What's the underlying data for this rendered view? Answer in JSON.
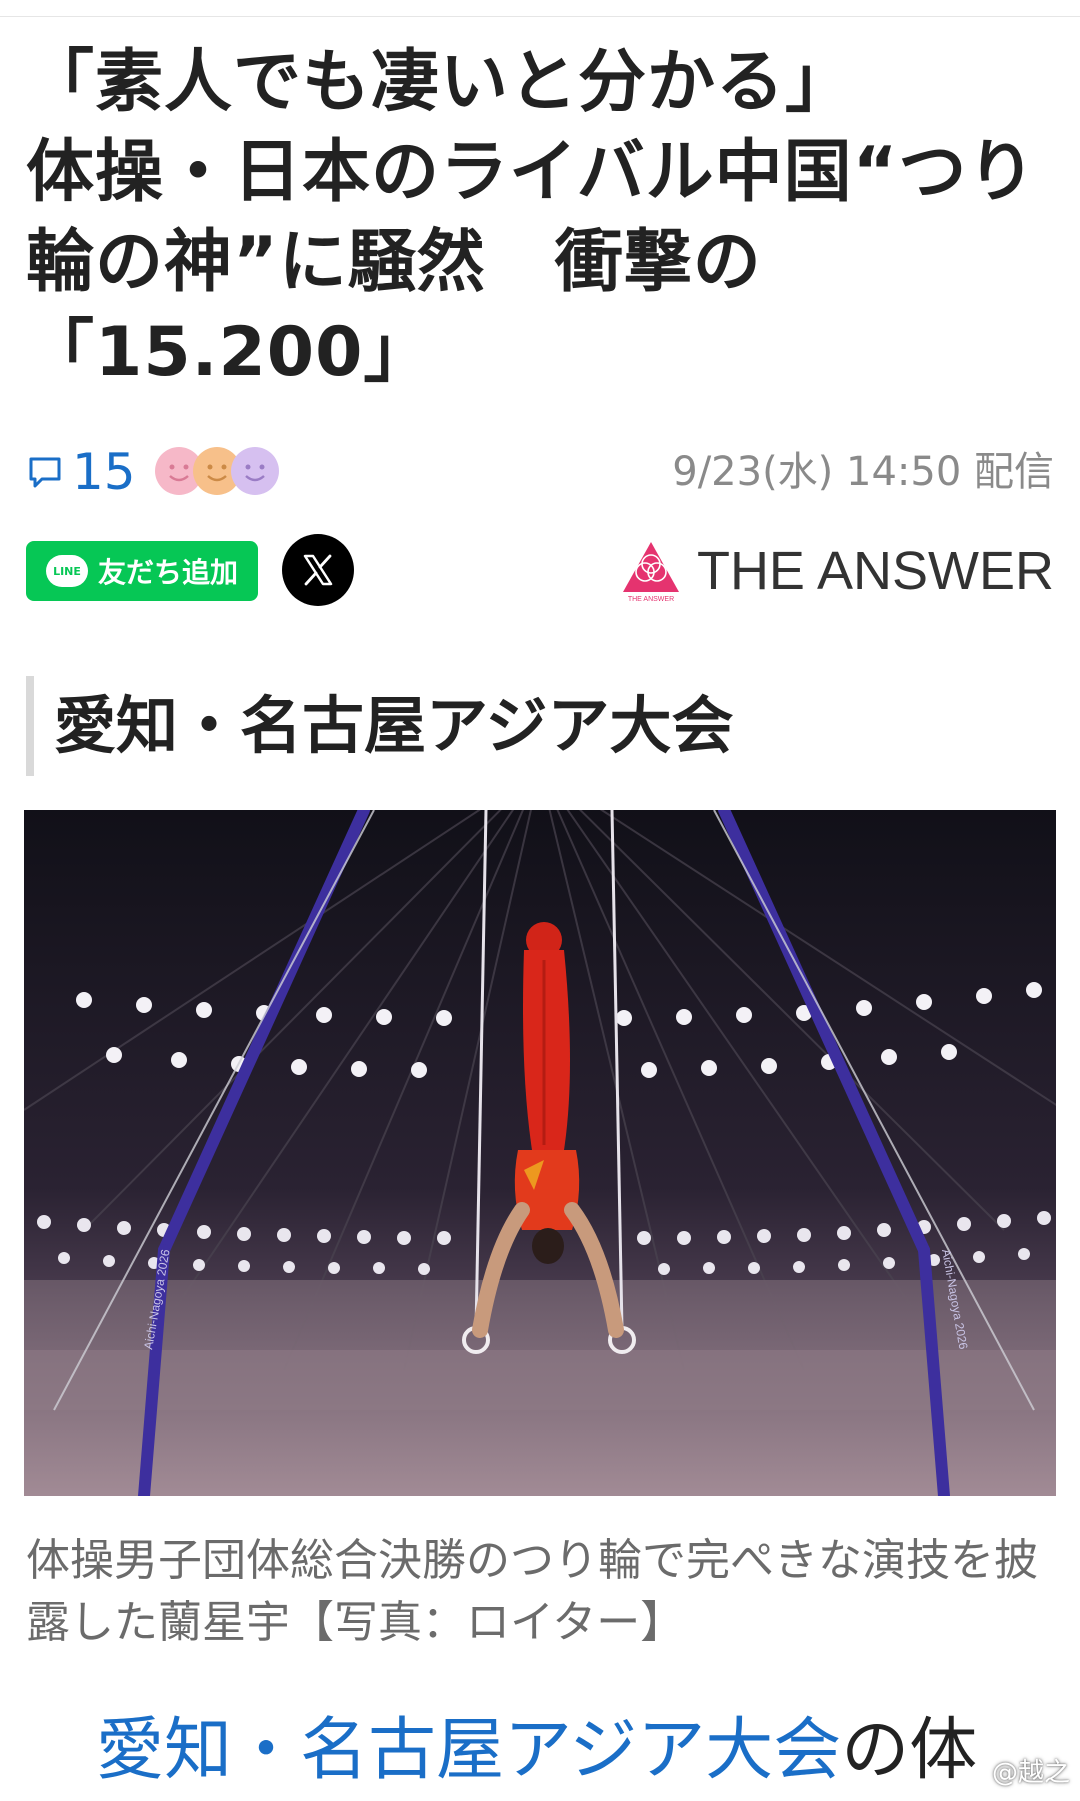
{
  "article": {
    "headline": "「素人でも凄いと分かる」\n体操・日本のライバル中国“つり輪の神”に騒然　衝撃の\n「15.200」",
    "comment_count": "15",
    "publish_time": "9/23(水) 14:50 配信",
    "section_heading": "愛知・名古屋アジア大会",
    "photo_caption": "体操男子団体総合決勝のつり輪で完ぺきな演技を披露した蘭星宇【写真：ロイター】",
    "lead_link": "愛知・名古屋アジア大会",
    "lead_rest": "の体"
  },
  "reactions": [
    {
      "icon": "smile-face-pink",
      "color": "#f6b8c8"
    },
    {
      "icon": "smile-face-orange",
      "color": "#f7c08a"
    },
    {
      "icon": "smile-face-purple",
      "color": "#d6c0f0"
    }
  ],
  "share": {
    "line_badge": "LINE",
    "line_label": "友だち追加",
    "x_icon": "x-logo-icon"
  },
  "publisher": {
    "name": "THE ANSWER",
    "logo_text": "THE ANSWER",
    "accent": "#e5336f"
  },
  "photo": {
    "venue_text": "Aichi-Nagoya 2026"
  },
  "watermark": "@越之",
  "colors": {
    "link": "#1a6ec7",
    "line_green": "#06c755",
    "meta_gray": "#8a8a8a"
  }
}
